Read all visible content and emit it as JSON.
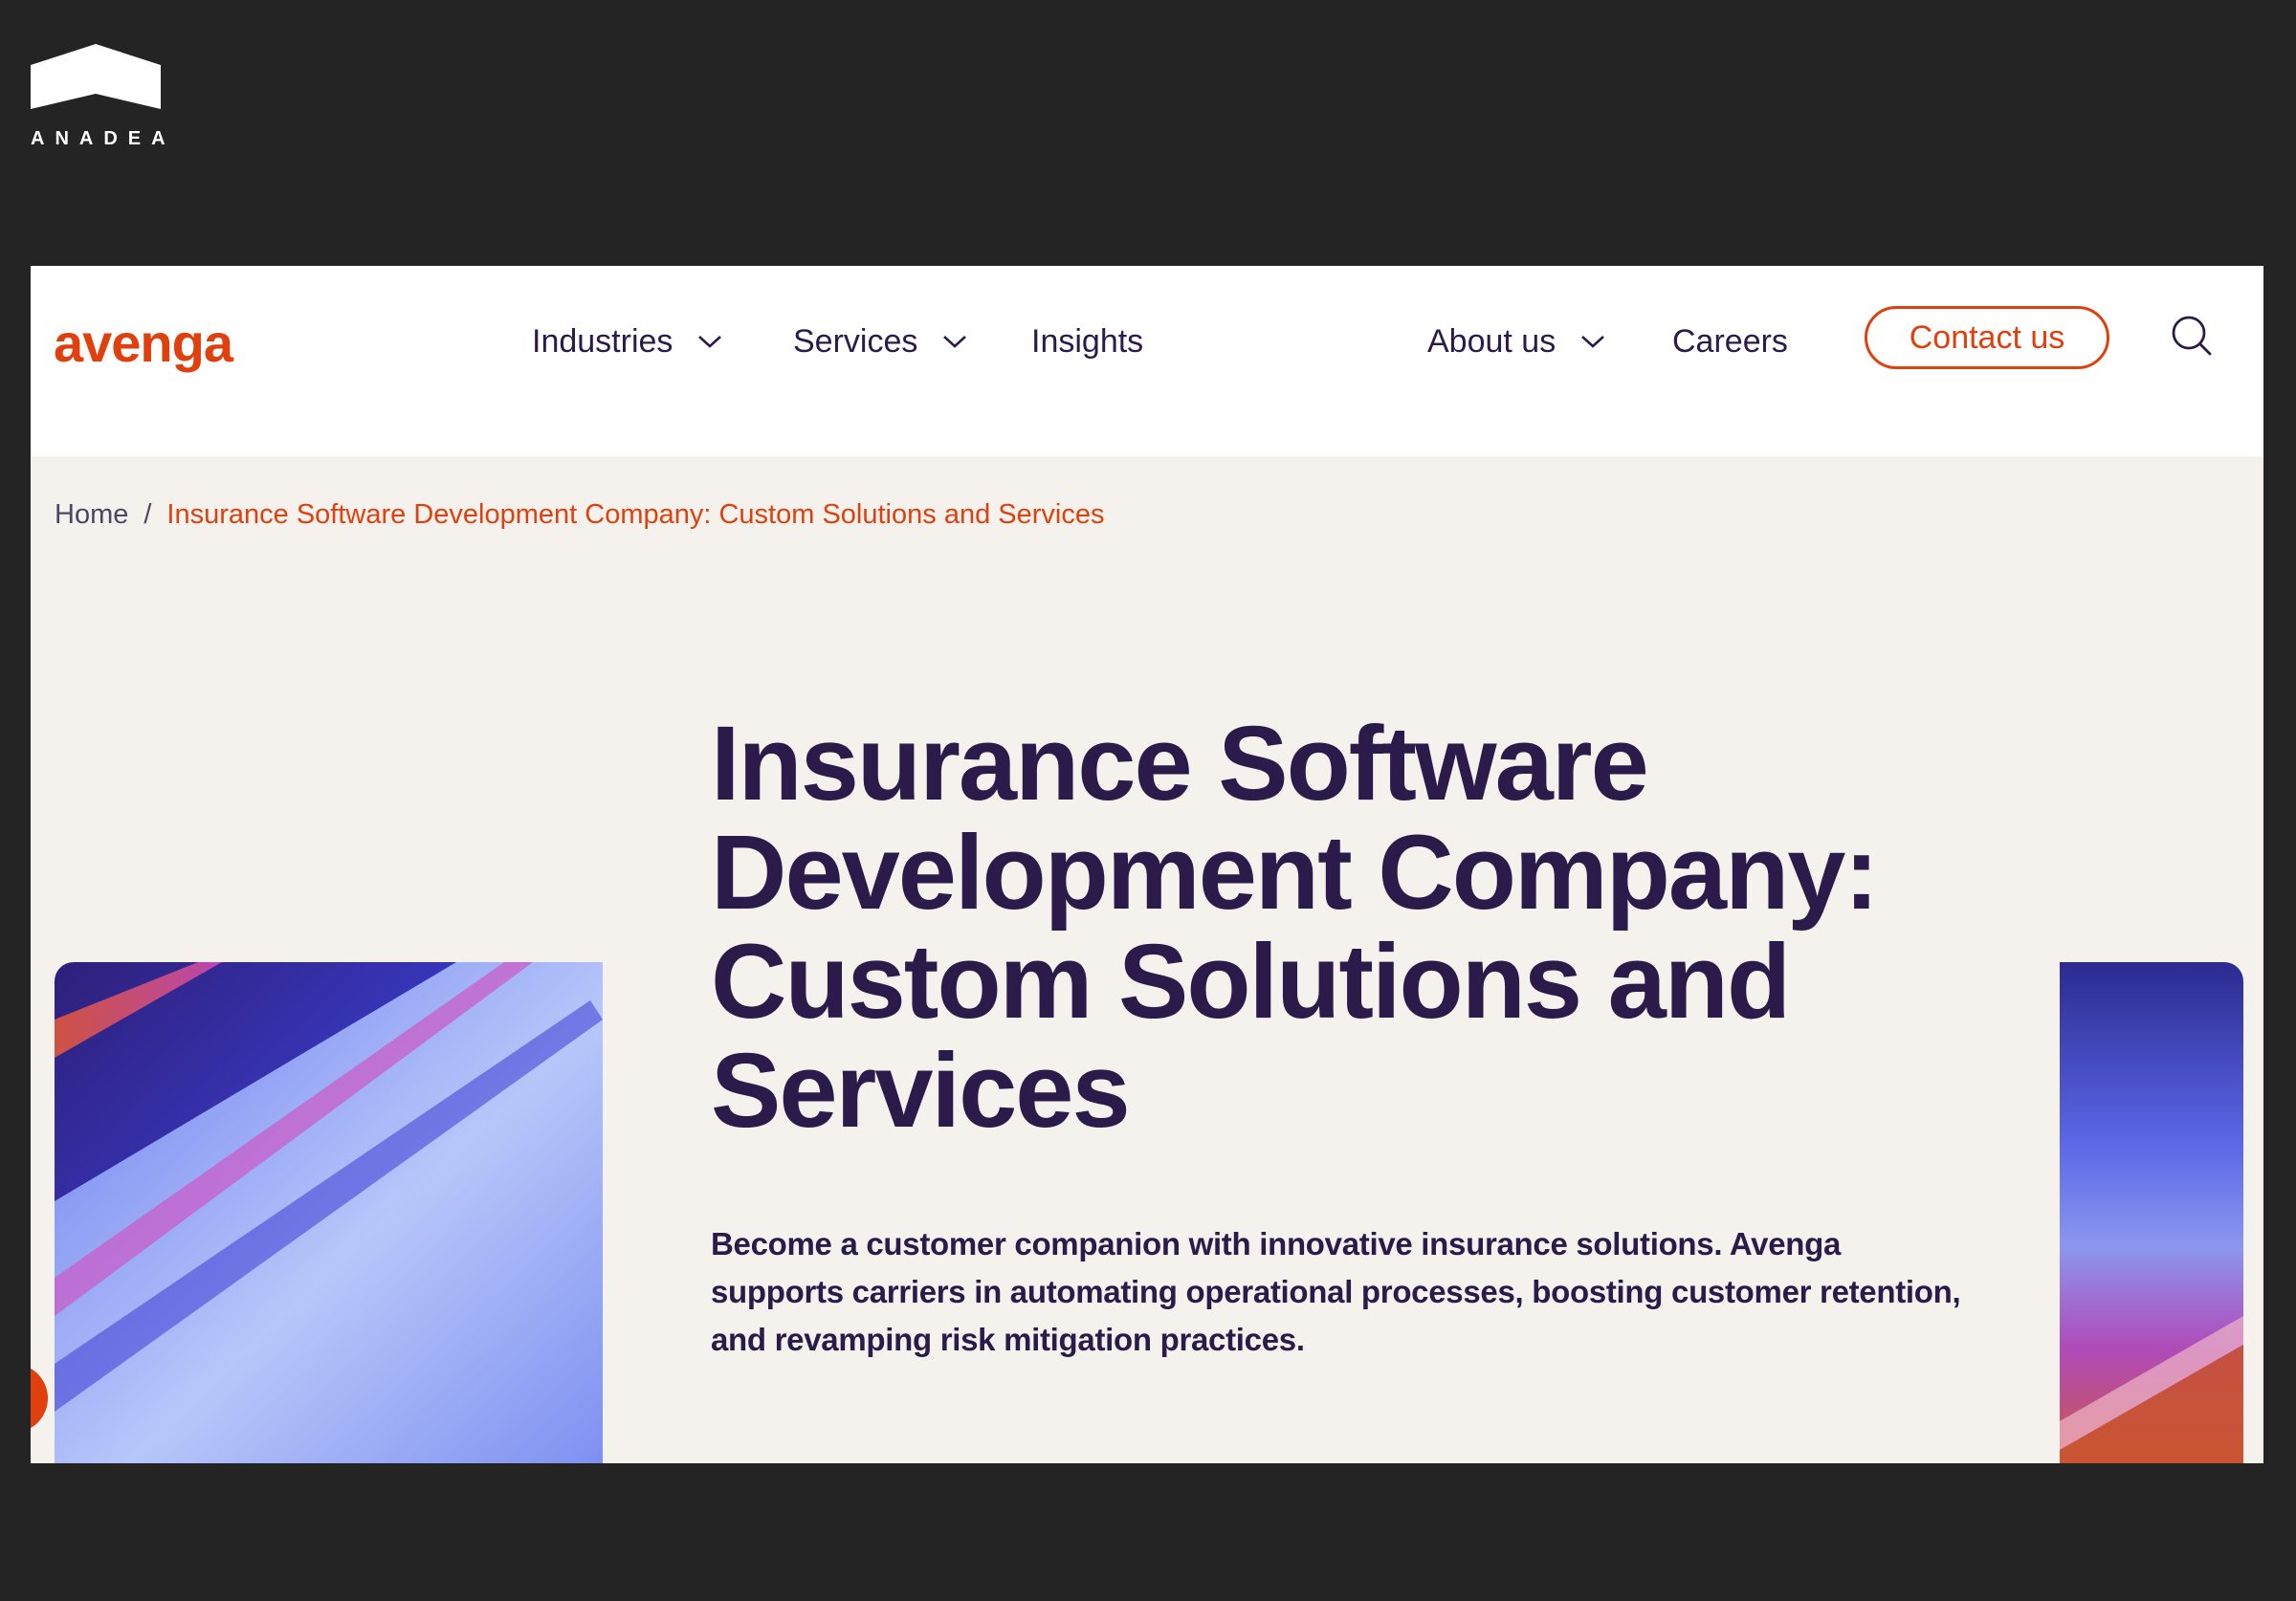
{
  "watermark": {
    "logo_text": "ANADEA"
  },
  "header": {
    "brand": "avenga",
    "nav": [
      {
        "label": "Industries",
        "has_dropdown": true
      },
      {
        "label": "Services",
        "has_dropdown": true
      },
      {
        "label": "Insights",
        "has_dropdown": false
      },
      {
        "label": "About us",
        "has_dropdown": true
      },
      {
        "label": "Careers",
        "has_dropdown": false
      }
    ],
    "contact_label": "Contact us",
    "search_icon": "search-icon"
  },
  "breadcrumb": {
    "home": "Home",
    "separator": "/",
    "current": "Insurance Software Development Company: Custom Solutions and Services"
  },
  "hero": {
    "title": "Insurance Software Development Company: Custom Solutions and Services",
    "subtitle": "Become a customer companion with innovative insurance solutions. Avenga supports carriers in automating operational processes, boosting customer retention, and revamping risk mitigation practices."
  },
  "colors": {
    "accent": "#e0400e",
    "text_dark": "#2b1b4a",
    "page_bg": "#f5f2ed",
    "outer_bg": "#242424"
  }
}
